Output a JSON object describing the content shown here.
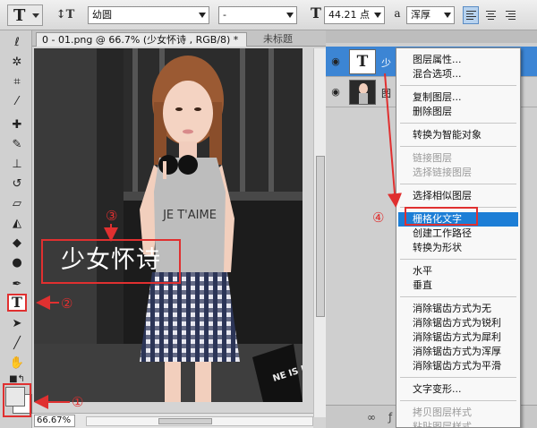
{
  "options_bar": {
    "font_family": "幼圆",
    "font_style": "-",
    "font_size": "44.21 点",
    "antialias_label": "a",
    "antialias_method": "浑厚"
  },
  "document": {
    "active_tab": "0 - 01.png @ 66.7% (少女怀诗 , RGB/8) *",
    "inactive_tab": "未标题",
    "zoom": "66.67%",
    "overlay_text": "少女怀诗"
  },
  "photo": {
    "shirt_text": "JE T'AIME",
    "bag_text": "NE IS NO"
  },
  "annotations": {
    "one": "①",
    "two": "②",
    "three": "③",
    "four": "④"
  },
  "layers": [
    {
      "name": "少",
      "type": "text",
      "selected": true
    },
    {
      "name": "图",
      "type": "image",
      "selected": false
    }
  ],
  "context_menu": {
    "groups": [
      [
        {
          "label": "图层属性...",
          "state": "normal"
        },
        {
          "label": "混合选项...",
          "state": "normal"
        }
      ],
      [
        {
          "label": "复制图层...",
          "state": "normal"
        },
        {
          "label": "删除图层",
          "state": "normal"
        }
      ],
      [
        {
          "label": "转换为智能对象",
          "state": "normal"
        }
      ],
      [
        {
          "label": "链接图层",
          "state": "disabled"
        },
        {
          "label": "选择链接图层",
          "state": "disabled"
        }
      ],
      [
        {
          "label": "选择相似图层",
          "state": "normal"
        }
      ],
      [
        {
          "label": "栅格化文字",
          "state": "highlighted"
        },
        {
          "label": "创建工作路径",
          "state": "normal"
        },
        {
          "label": "转换为形状",
          "state": "normal"
        }
      ],
      [
        {
          "label": "水平",
          "state": "normal"
        },
        {
          "label": "垂直",
          "state": "normal"
        }
      ],
      [
        {
          "label": "消除锯齿方式为无",
          "state": "normal"
        },
        {
          "label": "消除锯齿方式为锐利",
          "state": "normal"
        },
        {
          "label": "消除锯齿方式为犀利",
          "state": "normal"
        },
        {
          "label": "消除锯齿方式为浑厚",
          "state": "normal"
        },
        {
          "label": "消除锯齿方式为平滑",
          "state": "normal"
        }
      ],
      [
        {
          "label": "文字变形...",
          "state": "normal"
        }
      ],
      [
        {
          "label": "拷贝图层样式",
          "state": "disabled"
        },
        {
          "label": "粘贴图层样式",
          "state": "disabled"
        }
      ]
    ]
  },
  "colors": {
    "annotation_red": "#e03030",
    "menu_highlight": "#1c7ed6",
    "selected_layer": "#3c85d4"
  }
}
